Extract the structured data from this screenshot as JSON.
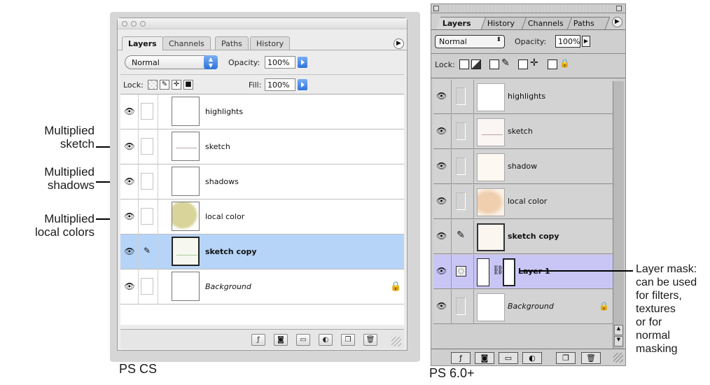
{
  "annotations": {
    "left": [
      {
        "line1": "Multiplied",
        "line2": "sketch"
      },
      {
        "line1": "Multiplied",
        "line2": "shadows"
      },
      {
        "line1": "Multiplied",
        "line2": "local colors"
      }
    ],
    "right": {
      "lines": [
        "Layer mask:",
        "can be used",
        "for filters,",
        "textures",
        "or for",
        "normal",
        "masking"
      ]
    },
    "captions": {
      "cs": "PS CS",
      "ps6": "PS 6.0+"
    }
  },
  "ps_cs": {
    "tabs": [
      "Layers",
      "Channels",
      "Paths",
      "History"
    ],
    "active_tab": "Layers",
    "blend_mode": "Normal",
    "opacity_label": "Opacity:",
    "opacity_value": "100%",
    "lock_label": "Lock:",
    "fill_label": "Fill:",
    "fill_value": "100%",
    "layers": [
      {
        "name": "highlights",
        "selected": false,
        "thumb_color": "#ffffff"
      },
      {
        "name": "sketch",
        "selected": false,
        "thumb_color": "#ffffff"
      },
      {
        "name": "shadows",
        "selected": false,
        "thumb_color": "#ffffff"
      },
      {
        "name": "local color",
        "selected": false,
        "thumb_color": "#d8d49a"
      },
      {
        "name": "sketch copy",
        "selected": true,
        "thumb_color": "#f6f8f0"
      },
      {
        "name": "Background",
        "selected": false,
        "thumb_color": "#ffffff"
      }
    ]
  },
  "ps6": {
    "tabs": [
      "Layers",
      "History",
      "Channels",
      "Paths"
    ],
    "active_tab": "Layers",
    "blend_mode": "Normal",
    "opacity_label": "Opacity:",
    "opacity_value": "100%",
    "lock_label": "Lock:",
    "layers": [
      {
        "name": "highlights",
        "selected": false,
        "thumb_color": "#ffffff"
      },
      {
        "name": "sketch",
        "selected": false,
        "thumb_color": "#fbf5f4"
      },
      {
        "name": "shadow",
        "selected": false,
        "thumb_color": "#fdf8f1"
      },
      {
        "name": "local color",
        "selected": false,
        "thumb_color": "#f4dcc2"
      },
      {
        "name": "sketch copy",
        "selected": false,
        "thumb_color": "#fbf6f0"
      },
      {
        "name": "Layer 1",
        "selected": true,
        "thumb_color": "#ffffff"
      },
      {
        "name": "Background",
        "selected": false,
        "thumb_color": "#ffffff"
      }
    ]
  },
  "colors": {
    "cs_selection": "#b6d4f7",
    "ps6_selection": "#c9c6f6",
    "mac_blue": "#2f72d8"
  }
}
